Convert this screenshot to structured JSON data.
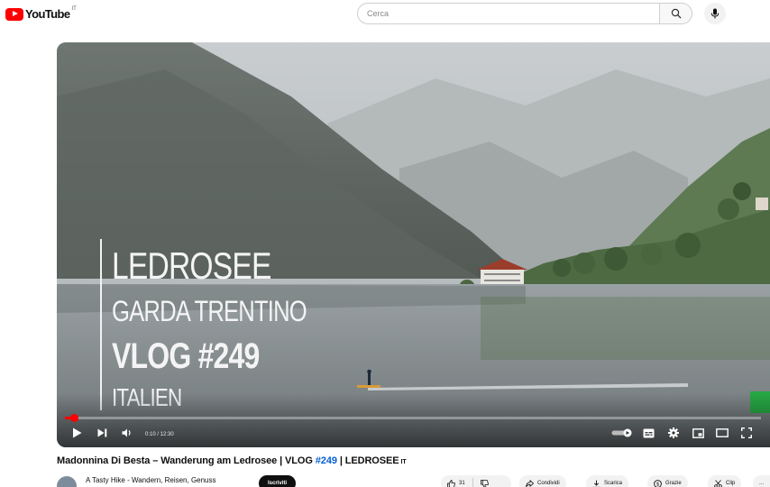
{
  "header": {
    "logo_text": "YouTube",
    "logo_country": "IT",
    "search_placeholder": "Cerca",
    "icons": [
      "youtube-logo-icon",
      "search-icon",
      "mic-icon"
    ]
  },
  "player": {
    "overlay": {
      "line1": "LEDROSEE",
      "line2": "GARDA TRENTINO",
      "line3": "VLOG #249",
      "line4": "ITALIEN"
    },
    "time": "0:10 / 12:30",
    "progress_fraction": 0.013,
    "icons": [
      "play-icon",
      "next-icon",
      "volume-icon",
      "autoplay-toggle-icon",
      "subtitles-icon",
      "settings-icon",
      "miniplayer-icon",
      "theater-icon",
      "fullscreen-icon"
    ]
  },
  "video": {
    "title_before": "Madonnina Di Besta – Wanderung am Ledrosee | VLOG ",
    "title_tag": "#249",
    "title_after": " | LEDROSEE",
    "title_suffix": "IT"
  },
  "channel": {
    "name": "A Tasty Hike - Wandern, Reisen, Genuss",
    "subscribe_label": "Iscriviti"
  },
  "actions": {
    "likes": "31",
    "share": "Condividi",
    "download": "Scarica",
    "thanks": "Grazie",
    "clip": "Clip",
    "more": "..."
  },
  "colors": {
    "brand_red": "#ff0000",
    "link_blue": "#065fd4",
    "pill_bg": "#f2f2f2"
  }
}
